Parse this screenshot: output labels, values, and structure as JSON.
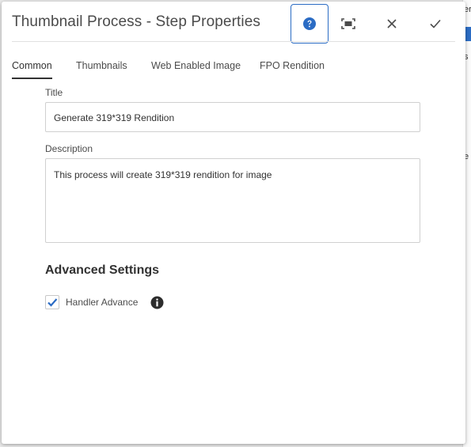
{
  "window": {
    "title": "Thumbnail Process - Step Properties"
  },
  "toolbar": {
    "help_icon": "help-circle-icon",
    "fullscreen_icon": "fullscreen-icon",
    "close_icon": "close-icon",
    "done_icon": "checkmark-icon"
  },
  "tabs": [
    {
      "label": "Common",
      "active": true
    },
    {
      "label": "Thumbnails",
      "active": false
    },
    {
      "label": "Web Enabled Image",
      "active": false
    },
    {
      "label": "FPO Rendition",
      "active": false
    }
  ],
  "form": {
    "title_label": "Title",
    "title_value": "Generate 319*319 Rendition",
    "description_label": "Description",
    "description_value": "This process will create 319*319 rendition for image"
  },
  "advanced": {
    "heading": "Advanced Settings",
    "handler_advance_label": "Handler Advance",
    "handler_advance_checked": true,
    "info_icon": "info-icon"
  },
  "background": {
    "fragments": [
      "er",
      "s",
      "e"
    ]
  },
  "colors": {
    "accent": "#2b6cc4",
    "text": "#4b4b4b"
  }
}
